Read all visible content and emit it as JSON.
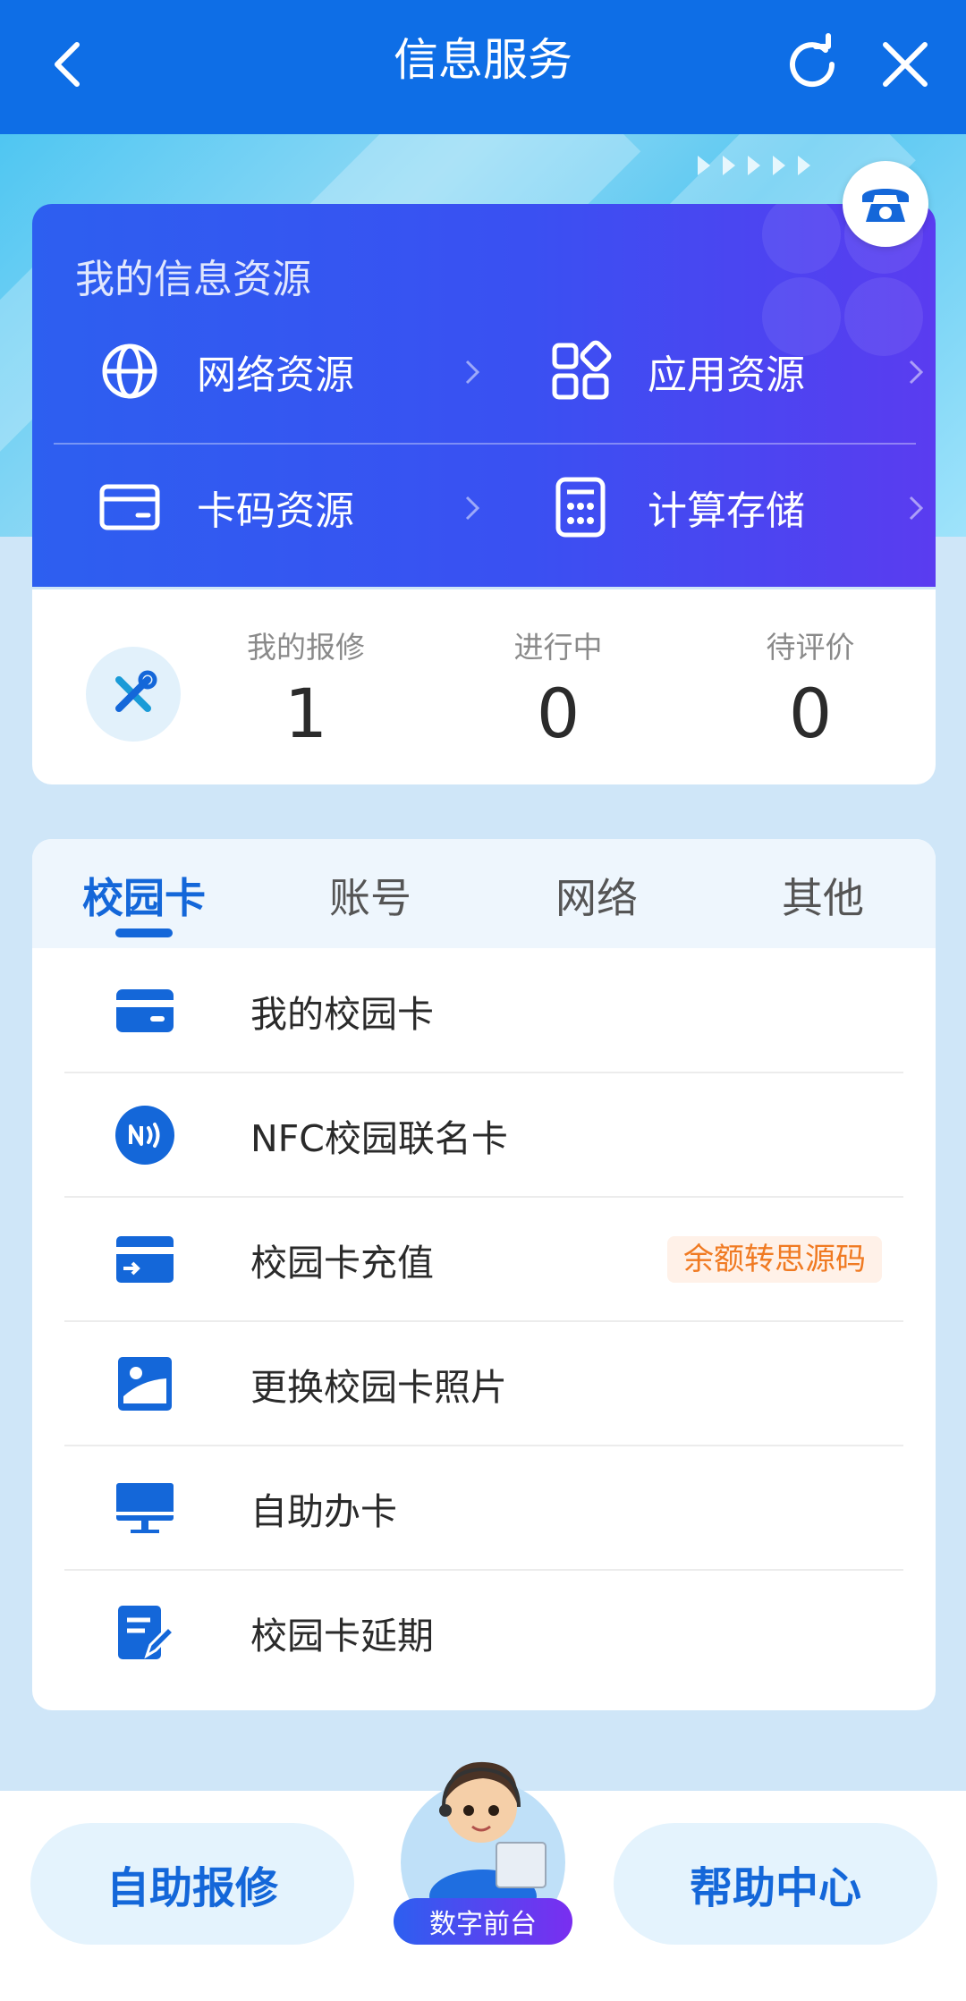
{
  "header": {
    "title": "信息服务"
  },
  "resources": {
    "heading": "我的信息资源",
    "items": [
      {
        "label": "网络资源",
        "icon": "globe-icon"
      },
      {
        "label": "应用资源",
        "icon": "apps-grid-icon"
      },
      {
        "label": "卡码资源",
        "icon": "card-icon"
      },
      {
        "label": "计算存储",
        "icon": "calculator-icon"
      }
    ]
  },
  "repair": {
    "stats": [
      {
        "label": "我的报修",
        "value": "1"
      },
      {
        "label": "进行中",
        "value": "0"
      },
      {
        "label": "待评价",
        "value": "0"
      }
    ]
  },
  "tabs": [
    {
      "label": "校园卡",
      "active": true
    },
    {
      "label": "账号",
      "active": false
    },
    {
      "label": "网络",
      "active": false
    },
    {
      "label": "其他",
      "active": false
    }
  ],
  "list": [
    {
      "label": "我的校园卡",
      "icon": "campus-card-icon"
    },
    {
      "label": "NFC校园联名卡",
      "icon": "nfc-icon"
    },
    {
      "label": "校园卡充值",
      "icon": "card-recharge-icon",
      "badge": "余额转思源码"
    },
    {
      "label": "更换校园卡照片",
      "icon": "photo-icon"
    },
    {
      "label": "自助办卡",
      "icon": "monitor-icon"
    },
    {
      "label": "校园卡延期",
      "icon": "edit-document-icon"
    }
  ],
  "bottom": {
    "left_button": "自助报修",
    "center_label": "数字前台",
    "right_button": "帮助中心"
  },
  "colors": {
    "primary": "#0e6ee6",
    "accent_blue": "#1467d9",
    "badge_orange": "#f07a22"
  }
}
